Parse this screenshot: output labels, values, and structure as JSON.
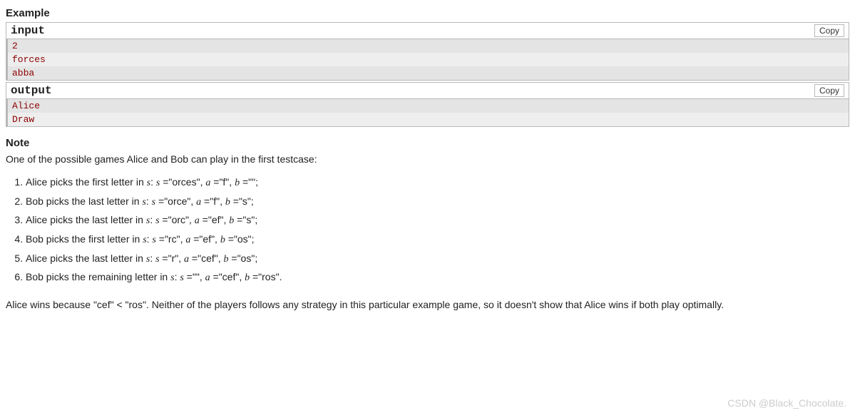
{
  "headings": {
    "example": "Example",
    "note": "Note"
  },
  "io": {
    "input_label": "input",
    "output_label": "output",
    "copy_label": "Copy",
    "input_lines": [
      "2",
      "forces",
      "abba"
    ],
    "output_lines": [
      "Alice",
      "Draw"
    ]
  },
  "note": {
    "intro": "One of the possible games Alice and Bob can play in the first testcase:",
    "steps": [
      {
        "prefix": "Alice picks the first letter in ",
        "s_val": "\"orces\"",
        "a_val": "\"f\"",
        "b_val": "\"\"",
        "tail": ";"
      },
      {
        "prefix": "Bob picks the last letter in ",
        "s_val": "\"orce\"",
        "a_val": "\"f\"",
        "b_val": "\"s\"",
        "tail": ";"
      },
      {
        "prefix": "Alice picks the last letter in ",
        "s_val": "\"orc\"",
        "a_val": "\"ef\"",
        "b_val": "\"s\"",
        "tail": ";"
      },
      {
        "prefix": "Bob picks the first letter in ",
        "s_val": "\"rc\"",
        "a_val": "\"ef\"",
        "b_val": "\"os\"",
        "tail": ";"
      },
      {
        "prefix": "Alice picks the last letter in ",
        "s_val": "\"r\"",
        "a_val": "\"cef\"",
        "b_val": "\"os\"",
        "tail": ";"
      },
      {
        "prefix": "Bob picks the remaining letter in ",
        "s_val": "\"\"",
        "a_val": "\"cef\"",
        "b_val": "\"ros\"",
        "tail": "."
      }
    ],
    "vars": {
      "s": "s",
      "a": "a",
      "b": "b"
    },
    "outro": "Alice wins because \"cef\" < \"ros\". Neither of the players follows any strategy in this particular example game, so it doesn't show that Alice wins if both play optimally."
  },
  "watermark": "CSDN @Black_Chocolate."
}
